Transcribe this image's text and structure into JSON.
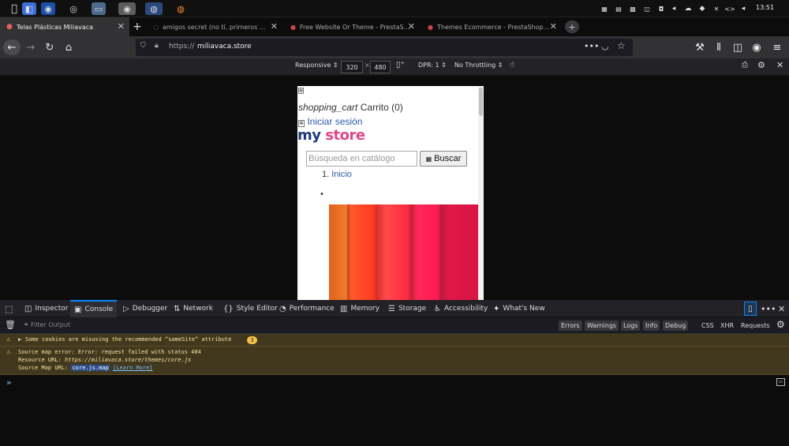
{
  "os_bar": {
    "clock": "13:51",
    "apple_icon": "apple-icon",
    "taskbar_icons": [
      "finder-icon",
      "chrome-icon",
      "browser-icon",
      "window-icon",
      "chrome-icon",
      "firefox-icon",
      "firefox-icon"
    ]
  },
  "tabs": [
    {
      "title": "Telas Plásticas Miliavaca",
      "active": true
    },
    {
      "title": "amigos secret (no tí, primeros ...",
      "active": false
    },
    {
      "title": "Free Website Or Theme - PrestaS...",
      "active": false
    },
    {
      "title": "Themes Ecommerce - PrestaShop...",
      "active": false
    }
  ],
  "new_tab_label": "+",
  "navbar": {
    "url_prefix": "https://",
    "url_host": "miliavaca.store"
  },
  "rdm": {
    "device": "Responsive",
    "width": "320",
    "x": "×",
    "height": "480",
    "dpr": "DPR: 1",
    "throttling": "No Throttling"
  },
  "page": {
    "shopping_cart_icon_text": "shopping_cart",
    "cart_label": "Carrito (0)",
    "login_label": "Iniciar sesión",
    "logo_my": "my",
    "logo_store": "store",
    "search_placeholder": "Búsqueda en catálogo",
    "search_button": "Buscar",
    "breadcrumb_num": "1.",
    "breadcrumb_item": "Inicio",
    "bullet": "•"
  },
  "devtools": {
    "tabs": [
      {
        "label": "Inspector",
        "icon": "inspector-icon"
      },
      {
        "label": "Console",
        "icon": "console-icon",
        "active": true
      },
      {
        "label": "Debugger",
        "icon": "debugger-icon"
      },
      {
        "label": "Network",
        "icon": "network-icon"
      },
      {
        "label": "Style Editor",
        "icon": "style-editor-icon"
      },
      {
        "label": "Performance",
        "icon": "performance-icon"
      },
      {
        "label": "Memory",
        "icon": "memory-icon"
      },
      {
        "label": "Storage",
        "icon": "storage-icon"
      },
      {
        "label": "Accessibility",
        "icon": "accessibility-icon"
      },
      {
        "label": "What's New",
        "icon": "whats-new-icon"
      }
    ],
    "filter_placeholder": "Filter Output",
    "filters": [
      "Errors",
      "Warnings",
      "Logs",
      "Info",
      "Debug"
    ],
    "filters_plain": [
      "CSS",
      "XHR",
      "Requests"
    ],
    "messages": {
      "cookie_warning": "Some cookies are misusing the recommended “sameSite“ attribute",
      "cookie_count": "3",
      "sourcemap_line1": "Source map error: Error: request failed with status 404",
      "sourcemap_line2_label": "Resource URL:",
      "sourcemap_line2_value": "https://miliavaca.store/themes/core.js",
      "sourcemap_line3_label": "Source Map URL:",
      "sourcemap_line3_value": "core.js.map",
      "learn_more": "[Learn More]"
    },
    "prompt": "»"
  }
}
